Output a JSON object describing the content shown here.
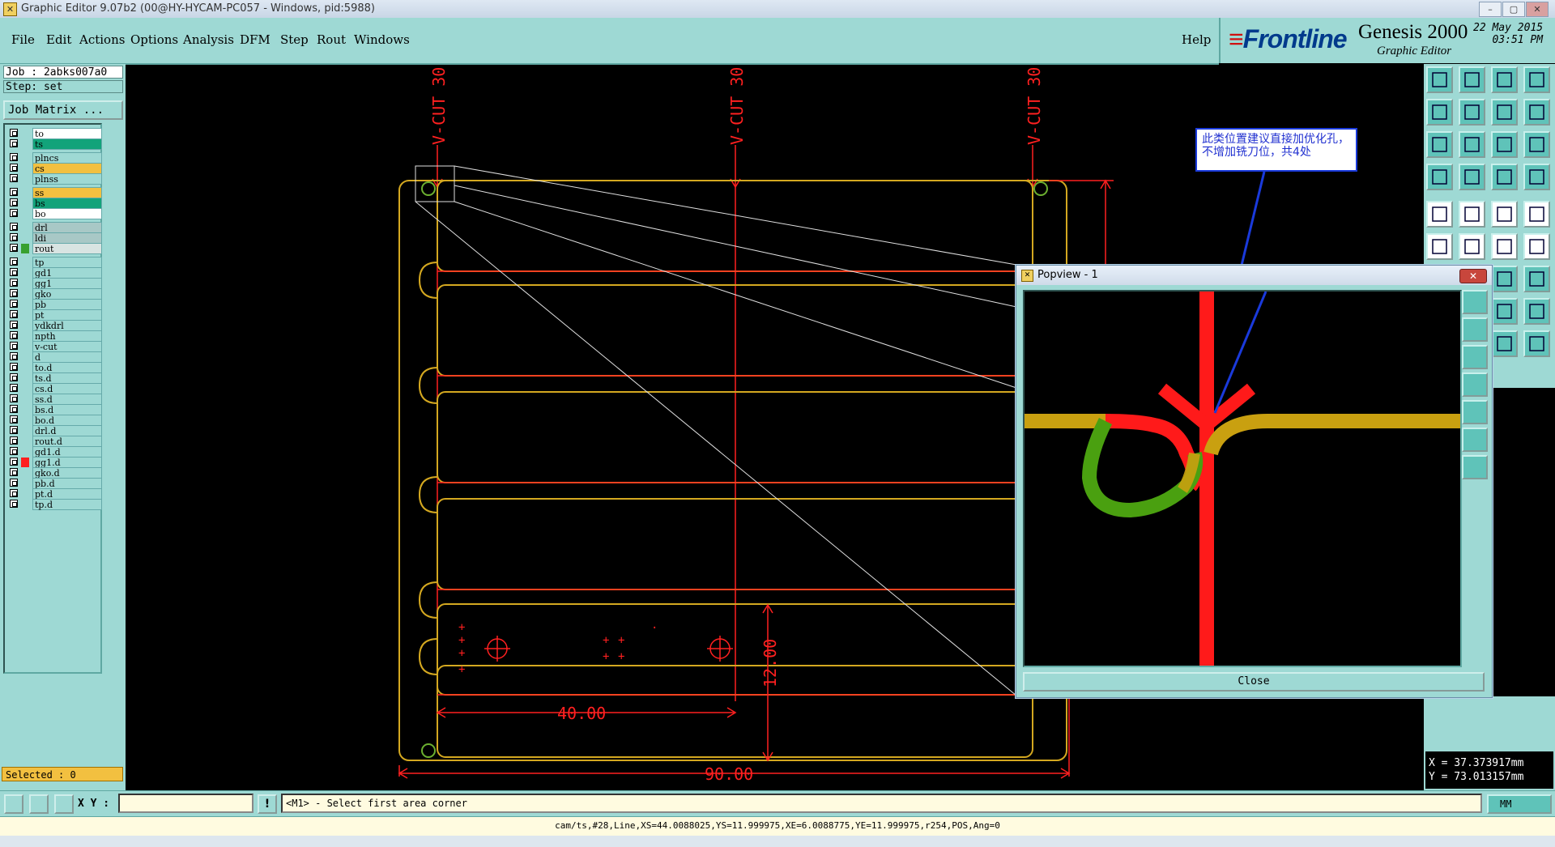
{
  "window": {
    "title": "Graphic Editor 9.07b2 (00@HY-HYCAM-PC057 - Windows, pid:5988)",
    "buttons": [
      "–",
      "▢",
      "✕"
    ]
  },
  "menu": {
    "items": [
      "File",
      "Edit",
      "Actions",
      "Options",
      "Analysis",
      "DFM",
      "Step",
      "Rout",
      "Windows"
    ],
    "help": "Help"
  },
  "brand": {
    "logo_main": "Front",
    "logo_accent": "line",
    "product": "Genesis 2000",
    "subtitle": "Graphic Editor",
    "date": "22 May 2015",
    "time": "03:51 PM"
  },
  "job": {
    "job": "Job : 2abks007a0",
    "step": "Step: set",
    "matrix_button": "Job Matrix ..."
  },
  "layers": [
    {
      "name": "to",
      "color": "#ffffff"
    },
    {
      "name": "ts",
      "color": "#12a37a"
    },
    {
      "name": "plncs",
      "color": "#9ed9d4"
    },
    {
      "name": "cs",
      "color": "#f2c040"
    },
    {
      "name": "plnss",
      "color": "#9ed9d4"
    },
    {
      "name": "ss",
      "color": "#f2c040"
    },
    {
      "name": "bs",
      "color": "#12a37a"
    },
    {
      "name": "bo",
      "color": "#ffffff"
    },
    {
      "name": "drl",
      "color": "#a8c8c6"
    },
    {
      "name": "ldi",
      "color": "#a8c8c6"
    },
    {
      "name": "rout",
      "color": "#d8e4e2"
    },
    {
      "name": "tp",
      "color": "#9ed9d4"
    },
    {
      "name": "gd1",
      "color": "#9ed9d4"
    },
    {
      "name": "gg1",
      "color": "#9ed9d4"
    },
    {
      "name": "gko",
      "color": "#9ed9d4"
    },
    {
      "name": "pb",
      "color": "#9ed9d4"
    },
    {
      "name": "pt",
      "color": "#9ed9d4"
    },
    {
      "name": "ydkdrl",
      "color": "#9ed9d4"
    },
    {
      "name": "npth",
      "color": "#9ed9d4"
    },
    {
      "name": "v-cut",
      "color": "#9ed9d4"
    },
    {
      "name": "d",
      "color": "#9ed9d4"
    },
    {
      "name": "to.d",
      "color": "#9ed9d4"
    },
    {
      "name": "ts.d",
      "color": "#9ed9d4"
    },
    {
      "name": "cs.d",
      "color": "#9ed9d4"
    },
    {
      "name": "ss.d",
      "color": "#9ed9d4"
    },
    {
      "name": "bs.d",
      "color": "#9ed9d4"
    },
    {
      "name": "bo.d",
      "color": "#9ed9d4"
    },
    {
      "name": "drl.d",
      "color": "#9ed9d4"
    },
    {
      "name": "rout.d",
      "color": "#9ed9d4"
    },
    {
      "name": "gd1.d",
      "color": "#9ed9d4"
    },
    {
      "name": "gg1.d",
      "color": "#9ed9d4"
    },
    {
      "name": "gko.d",
      "color": "#9ed9d4"
    },
    {
      "name": "pb.d",
      "color": "#9ed9d4"
    },
    {
      "name": "pt.d",
      "color": "#9ed9d4"
    },
    {
      "name": "tp.d",
      "color": "#9ed9d4"
    }
  ],
  "selected": "Selected : 0",
  "canvas": {
    "vcut_label": "V-CUT 30",
    "dim_40": "40.00",
    "dim_90": "90.00",
    "dim_12": "12.00"
  },
  "callout": {
    "text": "此类位置建议直接加优化孔，不增加铣刀位，共4处"
  },
  "popview": {
    "title": "Popview - 1",
    "close_label": "Close"
  },
  "coords": {
    "x": "X = 37.373917mm",
    "y": "Y = 73.013157mm"
  },
  "status": {
    "xy_label": "X Y :",
    "xy_value": "",
    "message": "<M1> - Select first area corner",
    "units": "MM",
    "info": "cam/ts,#28,Line,XS=44.0088025,YS=11.999975,XE=6.0088775,YE=11.999975,r254,POS,Ang=0"
  }
}
